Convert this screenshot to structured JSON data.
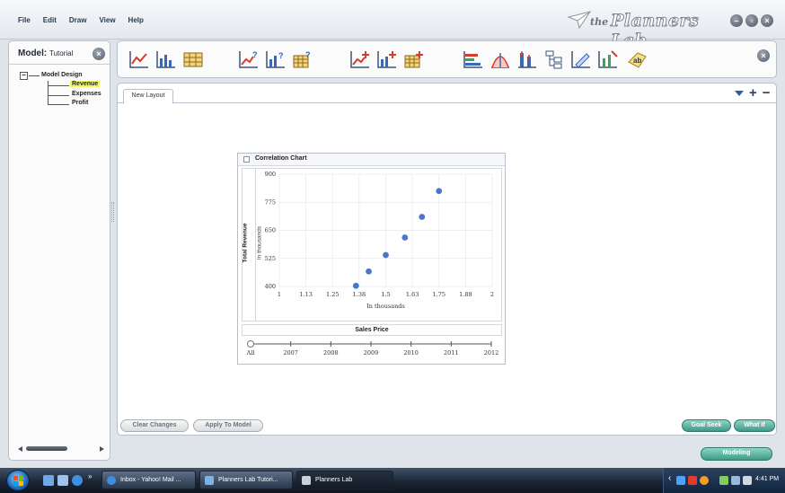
{
  "menu": {
    "items": [
      "File",
      "Edit",
      "Draw",
      "View",
      "Help"
    ]
  },
  "brand": {
    "prefix": "the",
    "name": "Planners Lab"
  },
  "window_buttons": [
    "minimize-icon",
    "restore-icon",
    "close-icon"
  ],
  "left_panel": {
    "title": "Model:",
    "model_name": "Tutorial",
    "tree": {
      "root": "Model Design",
      "children": [
        "Revenue",
        "Expenses",
        "Profit"
      ],
      "selected": "Revenue",
      "collapse_symbol": "−"
    }
  },
  "toolbar": {
    "groups": [
      [
        "line-chart-icon",
        "bar-chart-icon",
        "table-icon"
      ],
      [
        "line-chart-question-icon",
        "bar-chart-question-icon",
        "table-question-icon"
      ],
      [
        "line-chart-add-icon",
        "bar-chart-add-icon",
        "table-add-icon"
      ],
      [
        "horizontal-bar-icon",
        "distribution-icon",
        "compare-icon",
        "tree-icon",
        "pencil-icon",
        "edit-chart-icon",
        "text-label-icon"
      ]
    ],
    "text_label_icon_text": "ab"
  },
  "tabs": [
    {
      "label": "New Layout",
      "active": true
    }
  ],
  "tab_controls": {
    "add": "+",
    "remove": "−"
  },
  "chart_widget": {
    "title": "Correlation Chart"
  },
  "chart_data": {
    "type": "scatter",
    "title": "Correlation Chart",
    "ylabel": "Total Revenue",
    "y_unit": "In thousands",
    "xlabel": "Sales Price",
    "x_unit": "In thousands",
    "ylim": [
      400,
      900
    ],
    "xlim": [
      1,
      2
    ],
    "yticks": [
      "900",
      "775",
      "650",
      "525",
      "400"
    ],
    "xticks": [
      "1",
      "1.13",
      "1.25",
      "1.38",
      "1.5",
      "1.63",
      "1.75",
      "1.88",
      "2"
    ],
    "points": [
      {
        "x": 1.36,
        "y": 403
      },
      {
        "x": 1.42,
        "y": 467
      },
      {
        "x": 1.5,
        "y": 540
      },
      {
        "x": 1.59,
        "y": 618
      },
      {
        "x": 1.67,
        "y": 710
      },
      {
        "x": 1.75,
        "y": 825
      }
    ],
    "color": "#4b77c6",
    "grid": true,
    "slider": {
      "labels": [
        "All",
        "2007",
        "2008",
        "2009",
        "2010",
        "2011",
        "2012"
      ],
      "selected": "All"
    }
  },
  "buttons": {
    "clear_changes": "Clear Changes",
    "apply_to_model": "Apply To Model",
    "goal_seek": "Goal Seek",
    "what_if": "What If",
    "modeling": "Modeling"
  },
  "taskbar": {
    "windows": [
      {
        "label": "Inbox - Yahoo! Mail ...",
        "active": false
      },
      {
        "label": "Planners Lab Tutori...",
        "active": false
      },
      {
        "label": "Planners Lab",
        "active": true
      }
    ],
    "overflow": "»",
    "tray_chevron": "‹",
    "clock": "4:41 PM"
  }
}
